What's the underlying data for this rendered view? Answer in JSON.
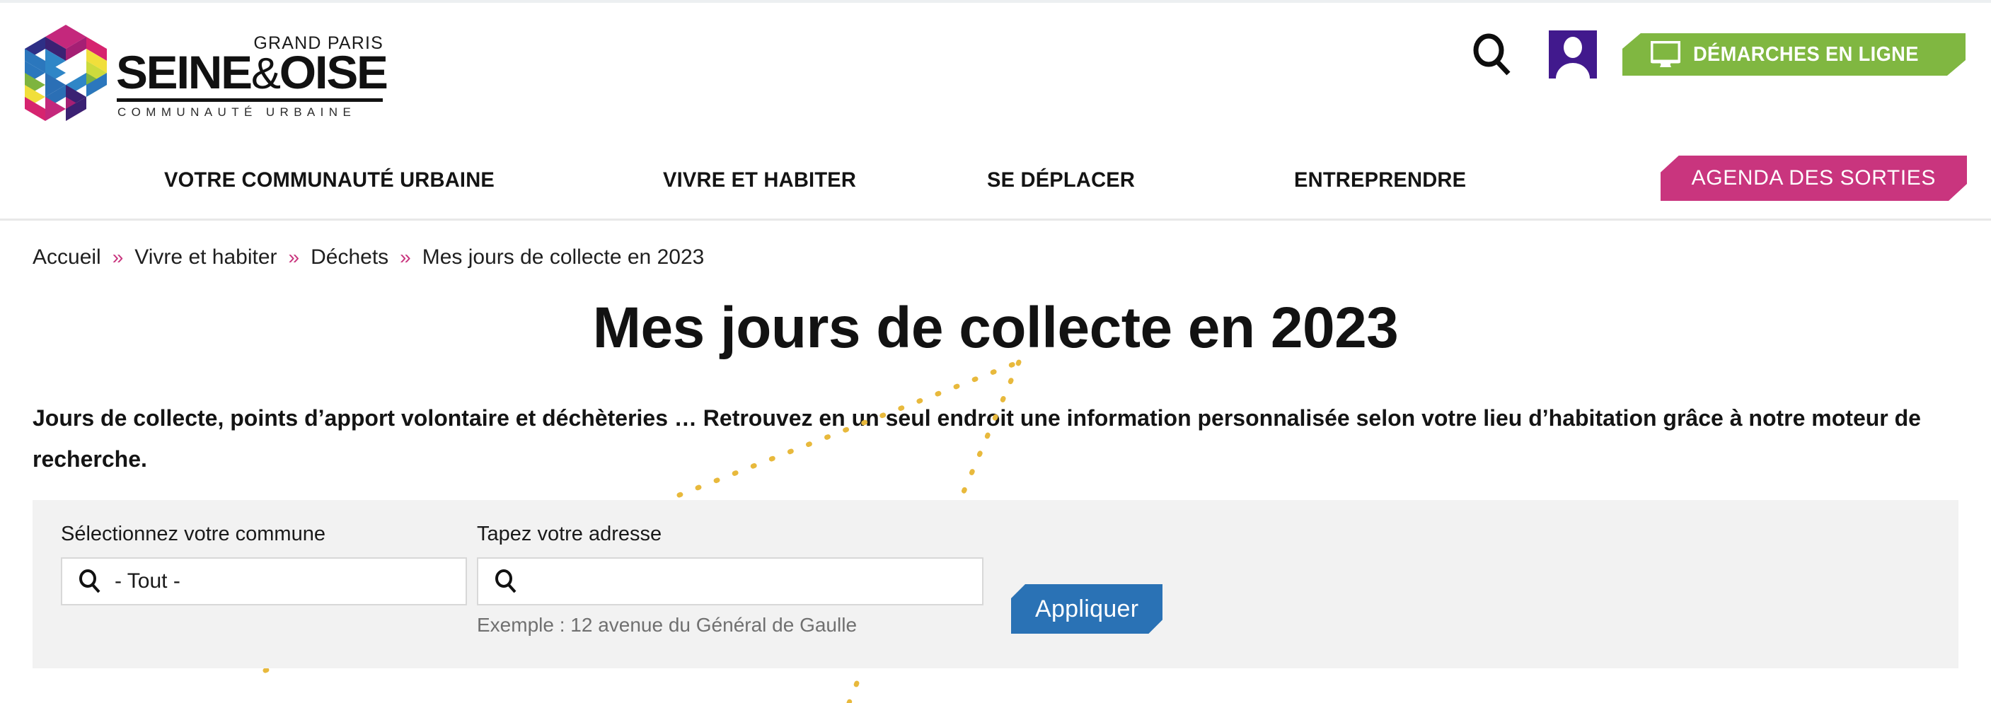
{
  "colors": {
    "accent_pink": "#c9357e",
    "accent_green": "#80b741",
    "accent_purple": "#41198d",
    "accent_blue": "#2a72b5",
    "deco_gold": "#e8b93c",
    "panel_grey": "#f2f2f2",
    "text_dark": "#141414"
  },
  "header": {
    "logo": {
      "kicker": "GRAND PARIS",
      "name_part1": "SEINE",
      "name_amp": "&",
      "name_part2": "OISE",
      "subtitle": "COMMUNAUTÉ URBAINE"
    },
    "actions": {
      "search_icon": "search-icon",
      "account_icon": "user-account-icon",
      "demarches_label": "DÉMARCHES EN LIGNE",
      "demarches_icon": "monitor-icon"
    }
  },
  "nav": {
    "items": [
      {
        "label": "VOTRE COMMUNAUTÉ URBAINE"
      },
      {
        "label": "VIVRE ET HABITER"
      },
      {
        "label": "SE DÉPLACER"
      },
      {
        "label": "ENTREPRENDRE"
      }
    ],
    "cta": {
      "label": "AGENDA DES SORTIES"
    }
  },
  "breadcrumb": {
    "separator": "»",
    "items": [
      {
        "label": "Accueil"
      },
      {
        "label": "Vivre et habiter"
      },
      {
        "label": "Déchets"
      },
      {
        "label": "Mes jours de collecte en 2023"
      }
    ]
  },
  "main": {
    "title": "Mes jours de collecte en 2023",
    "intro": "Jours de collecte, points d’apport volontaire et déchèteries … Retrouvez en un seul endroit une information personnalisée selon votre lieu d’habitation grâce à notre moteur de recherche."
  },
  "form": {
    "commune": {
      "label": "Sélectionnez votre commune",
      "value": "- Tout -",
      "placeholder": "- Tout -",
      "icon": "search-icon"
    },
    "adresse": {
      "label": "Tapez votre adresse",
      "value": "",
      "placeholder": "",
      "icon": "search-icon",
      "hint": "Exemple : 12 avenue du Général de Gaulle"
    },
    "submit": {
      "label": "Appliquer"
    }
  }
}
